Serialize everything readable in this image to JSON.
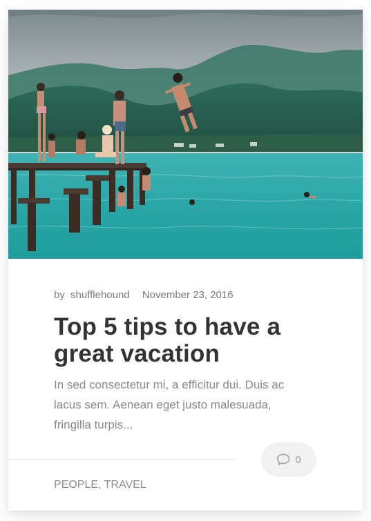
{
  "post": {
    "by_prefix": "by",
    "author": "shufflehound",
    "date": "November 23, 2016",
    "title": "Top 5 tips to have a great vacation",
    "excerpt": "In sed consectetur mi, a efficitur dui. Duis ac lacus sem. Aenean eget justo malesuada, fringilla turpis...",
    "comments_count": "0",
    "comments_icon": "speech-bubble-icon",
    "tags": [
      {
        "label": "PEOPLE",
        "separator": ", "
      },
      {
        "label": "TRAVEL",
        "separator": ""
      }
    ],
    "image_alt": "people jumping off a pier into turquoise water"
  },
  "colors": {
    "title": "#333333",
    "meta": "#7a7a7a",
    "excerpt": "#8a8a8a",
    "comment_pill_bg": "#f1f1f1",
    "water": "#2ba8a7"
  }
}
